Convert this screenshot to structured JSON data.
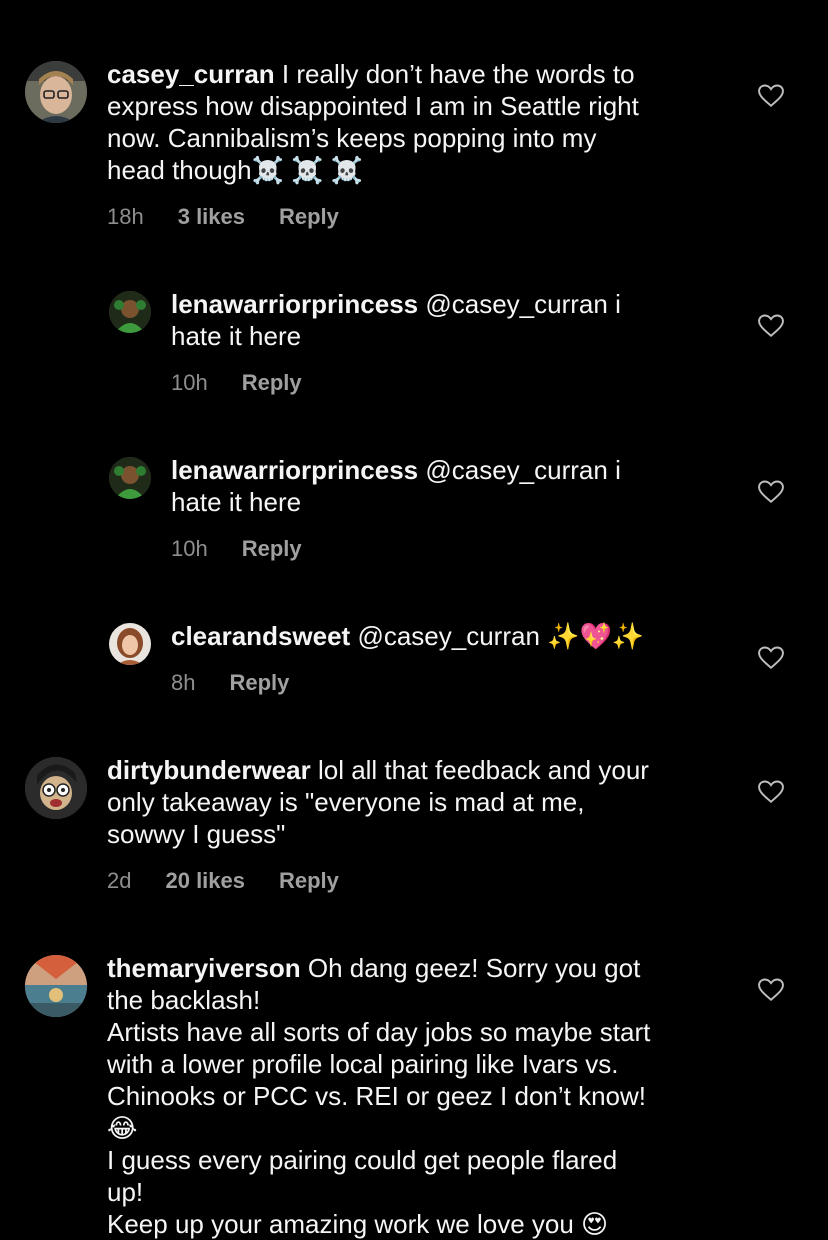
{
  "colors": {
    "background": "#000000",
    "text": "#f5f5f5",
    "meta": "#8e8e8e"
  },
  "comments": [
    {
      "user": "casey_curran",
      "text_lines": [
        "I really don’t have the words to",
        "express how disappointed I am in Seattle right",
        "now. Cannibalism’s keeps popping into my",
        "head though"
      ],
      "emoji": "☠️ ☠️ ☠️",
      "time": "18h",
      "likes": "3 likes",
      "reply": "Reply"
    },
    {
      "user": "lenawarriorprincess",
      "mention": "@casey_curran",
      "text_lines": [
        "i",
        "hate it here"
      ],
      "time": "10h",
      "reply": "Reply"
    },
    {
      "user": "lenawarriorprincess",
      "mention": "@casey_curran",
      "text_lines": [
        "i",
        "hate it here"
      ],
      "time": "10h",
      "reply": "Reply"
    },
    {
      "user": "clearandsweet",
      "mention": "@casey_curran",
      "emoji": "✨💖✨",
      "time": "8h",
      "reply": "Reply"
    },
    {
      "user": "dirtybunderwear",
      "text_lines": [
        "lol all that feedback and your",
        "only takeaway is \"everyone is mad at me,",
        "sowwy I guess\""
      ],
      "time": "2d",
      "likes": "20 likes",
      "reply": "Reply"
    },
    {
      "user": "themaryiverson",
      "text_lines": [
        "Oh dang geez! Sorry you got",
        "the backlash!",
        "Artists have all sorts of day jobs so maybe start",
        "with a lower profile local pairing like Ivars vs.",
        "Chinooks or PCC vs. REI or geez I don’t know!",
        "😂",
        "I guess every pairing could get people flared",
        "up!",
        "Keep up your amazing work we love you 😍"
      ]
    }
  ],
  "icons": {
    "like": "heart-outline-icon"
  }
}
